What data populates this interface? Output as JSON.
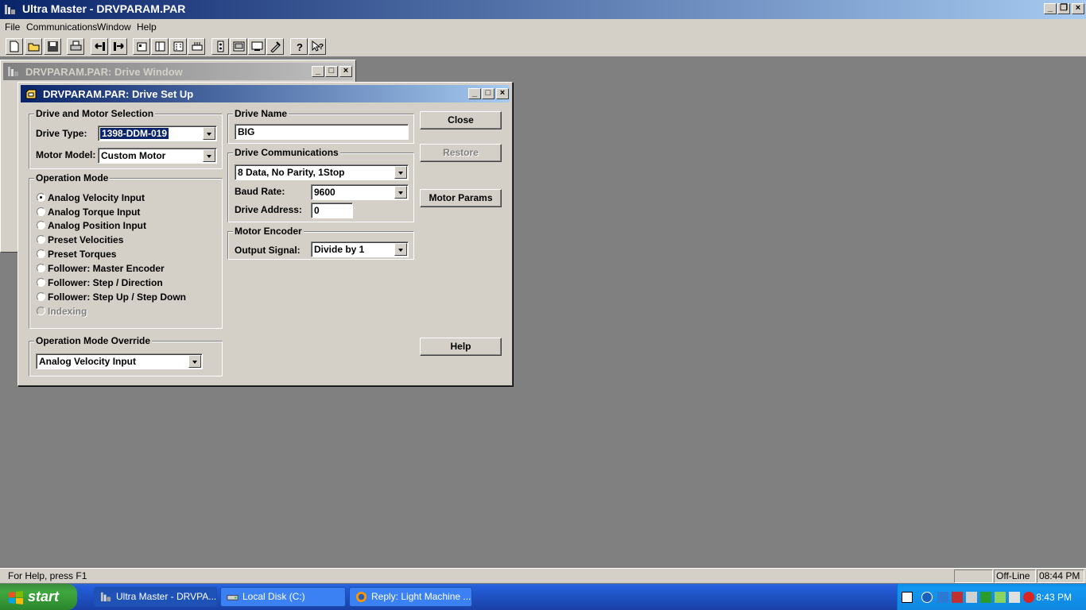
{
  "app": {
    "title": "Ultra Master - DRVPARAM.PAR"
  },
  "menu": [
    "File",
    "Communications",
    "Window",
    "Help"
  ],
  "toolbar_icons": [
    "new-icon",
    "open-icon",
    "save-icon",
    "print-icon",
    "upload-icon",
    "download-icon",
    "drive-setup-icon",
    "motor-icon",
    "io-icon",
    "tuning-icon",
    "oscilloscope-icon",
    "monitor-icon",
    "status-icon",
    "control-icon",
    "help-icon",
    "context-help-icon"
  ],
  "drive_window": {
    "title": "DRVPARAM.PAR: Drive Window"
  },
  "setup": {
    "title": "DRVPARAM.PAR: Drive Set Up",
    "drive_motor": {
      "group": "Drive and Motor Selection",
      "drive_type_label": "Drive Type:",
      "drive_type_value": "1398-DDM-019",
      "motor_model_label": "Motor Model:",
      "motor_model_value": "Custom Motor"
    },
    "operation_mode": {
      "group": "Operation Mode",
      "options": [
        {
          "label": "Analog Velocity Input",
          "selected": true,
          "enabled": true
        },
        {
          "label": "Analog Torque Input",
          "selected": false,
          "enabled": true
        },
        {
          "label": "Analog Position Input",
          "selected": false,
          "enabled": true
        },
        {
          "label": "Preset Velocities",
          "selected": false,
          "enabled": true
        },
        {
          "label": "Preset Torques",
          "selected": false,
          "enabled": true
        },
        {
          "label": "Follower: Master Encoder",
          "selected": false,
          "enabled": true
        },
        {
          "label": "Follower: Step / Direction",
          "selected": false,
          "enabled": true
        },
        {
          "label": "Follower: Step Up / Step Down",
          "selected": false,
          "enabled": true
        },
        {
          "label": "Indexing",
          "selected": false,
          "enabled": false
        }
      ]
    },
    "override": {
      "group": "Operation Mode Override",
      "value": "Analog Velocity Input"
    },
    "drive_name": {
      "group": "Drive Name",
      "value": "BIG"
    },
    "comms": {
      "group": "Drive Communications",
      "format_value": "8 Data, No Parity, 1Stop",
      "baud_label": "Baud Rate:",
      "baud_value": "9600",
      "address_label": "Drive Address:",
      "address_value": "0"
    },
    "encoder": {
      "group": "Motor Encoder",
      "output_label": "Output Signal:",
      "output_value": "Divide by 1"
    },
    "buttons": {
      "close": "Close",
      "restore": "Restore",
      "motor_params": "Motor Params",
      "help": "Help"
    }
  },
  "statusbar": {
    "help_text": "For Help, press F1",
    "mode": "Off-Line",
    "time": "08:44 PM"
  },
  "taskbar": {
    "start": "start",
    "tasks": [
      "Ultra Master - DRVPA...",
      "Local Disk (C:)",
      "Reply: Light Machine ..."
    ],
    "clock": "8:43 PM"
  },
  "colors": {
    "title_active": "#0a246a",
    "title_inactive": "#808080",
    "face": "#d4d0c8",
    "desktop": "#808080"
  }
}
